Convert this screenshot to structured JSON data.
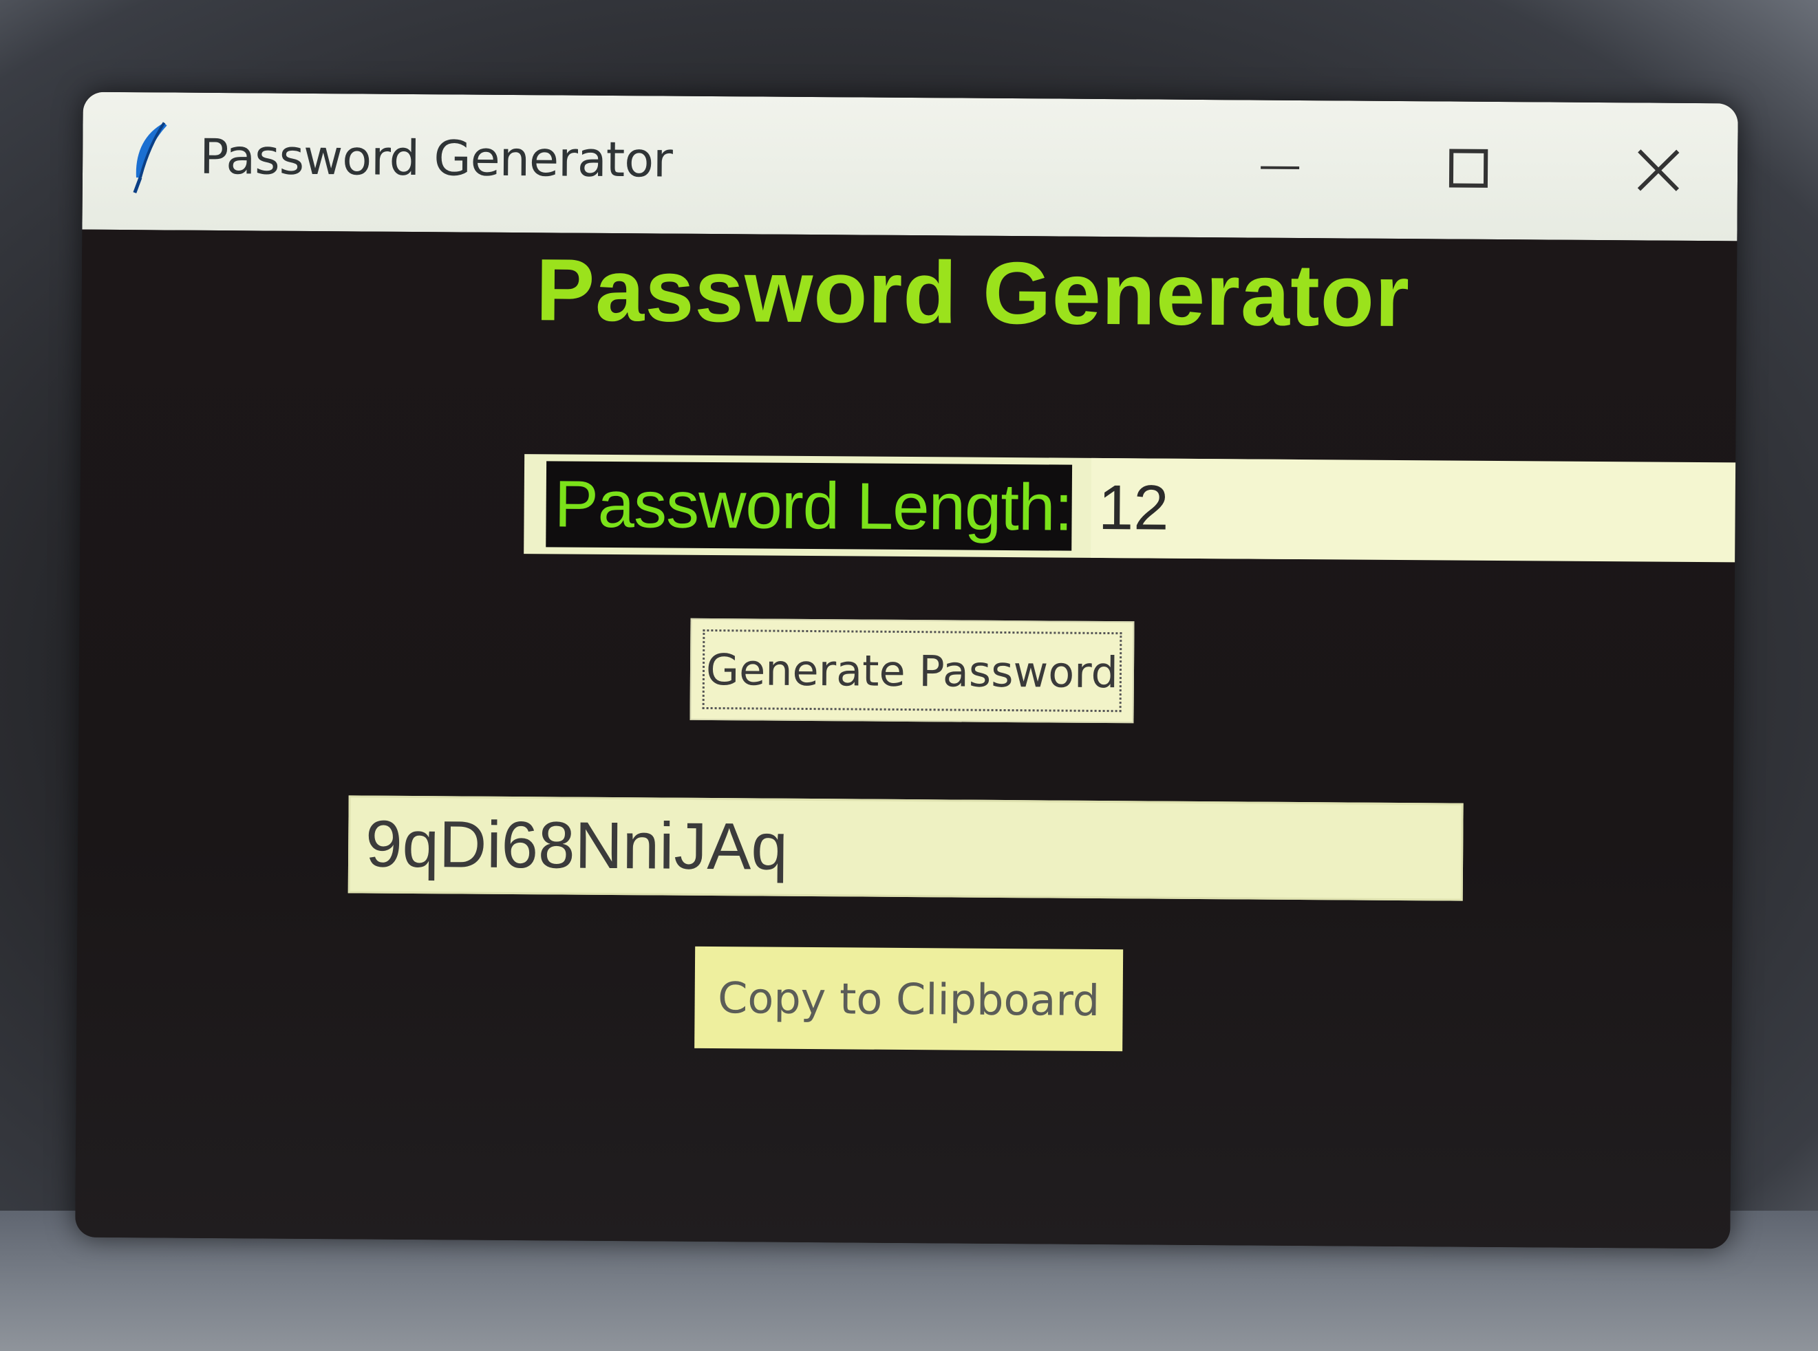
{
  "window": {
    "title": "Password Generator",
    "controls": {
      "minimize": "minimize-icon",
      "maximize": "maximize-icon",
      "close": "close-icon"
    }
  },
  "app": {
    "heading": "Password Generator",
    "length_label": "Password Length:",
    "length_value": "12",
    "generate_button": "Generate Password",
    "password_output": "9qDi68NniJAq",
    "copy_button": "Copy to Clipboard"
  },
  "colors": {
    "heading": "#9be21c",
    "label": "#7be21a",
    "background": "#1b1718",
    "input_bg": "#f4f6d0"
  }
}
